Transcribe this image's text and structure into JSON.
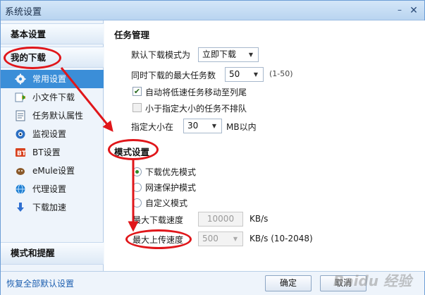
{
  "window": {
    "title": "系统设置"
  },
  "sidebar": {
    "group_basic": "基本设置",
    "group_download": "我的下载",
    "items": [
      {
        "label": "常用设置",
        "icon": "gear-icon"
      },
      {
        "label": "小文件下载",
        "icon": "small-file-download-icon"
      },
      {
        "label": "任务默认属性",
        "icon": "task-properties-icon"
      },
      {
        "label": "监视设置",
        "icon": "monitor-icon"
      },
      {
        "label": "BT设置",
        "icon": "bt-icon"
      },
      {
        "label": "eMule设置",
        "icon": "emule-icon"
      },
      {
        "label": "代理设置",
        "icon": "proxy-icon"
      },
      {
        "label": "下载加速",
        "icon": "download-accelerate-icon"
      }
    ],
    "group_mode": "模式和提醒"
  },
  "task": {
    "title": "任务管理",
    "default_mode_label": "默认下载模式为",
    "default_mode_value": "立即下载",
    "max_tasks_label": "同时下载的最大任务数",
    "max_tasks_value": "50",
    "max_tasks_range": "(1-50)",
    "auto_move_label": "自动将低速任务移动至列尾",
    "auto_move_checked": true,
    "no_queue_label": "小于指定大小的任务不排队",
    "no_queue_checked": false,
    "size_label": "指定大小在",
    "size_value": "30",
    "size_unit": "MB以内"
  },
  "mode": {
    "title": "模式设置",
    "options": [
      "下载优先模式",
      "网速保护模式",
      "自定义模式"
    ],
    "selected_index": 0,
    "max_down_label": "最大下载速度",
    "max_down_value": "10000",
    "max_down_unit": "KB/s",
    "max_up_label": "最大上传速度",
    "max_up_value": "500",
    "max_up_unit": "KB/s (10-2048)"
  },
  "footer": {
    "restore_link": "恢复全部默认设置",
    "ok_label": "确定",
    "cancel_label": "取消"
  },
  "colors": {
    "annotation": "#e0161a",
    "active_nav": "#3b8ed8"
  }
}
